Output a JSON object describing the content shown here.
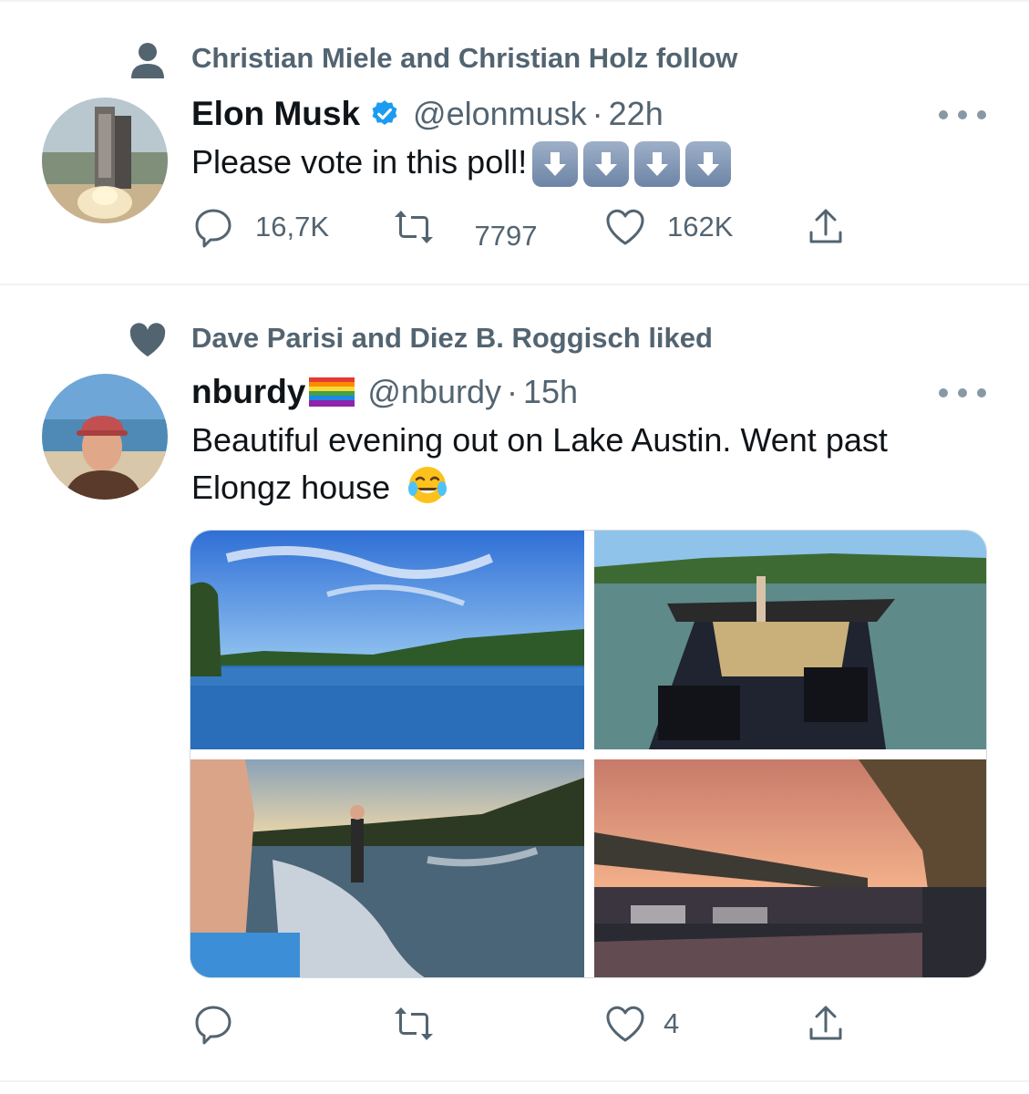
{
  "tweets": [
    {
      "social_context": "Christian Miele and Christian Holz follow",
      "name": "Elon Musk",
      "handle": "@elonmusk",
      "separator": "·",
      "time": "22h",
      "text": "Please vote in this poll!",
      "emoji": [
        "down-arrow-button",
        "down-arrow-button",
        "down-arrow-button",
        "down-arrow-button"
      ],
      "replies": "16,7K",
      "retweets_prev": "7797",
      "retweets": "7797",
      "likes": "162K"
    },
    {
      "social_context": "Dave Parisi and Diez B. Roggisch liked",
      "name": "nburdy",
      "name_emoji": "rainbow-flag",
      "handle": "@nburdy",
      "separator": "·",
      "time": "15h",
      "text_line1": "Beautiful evening out on Lake Austin. Went past",
      "text_line2": "Elongz house",
      "text_emoji": "tears-of-joy-face",
      "replies": "",
      "retweets": "",
      "likes": "4",
      "photos": [
        "lake-view",
        "boat-deck",
        "wakesurfing",
        "boathouse-sunset"
      ]
    }
  ],
  "colors": {
    "secondary_text": "#536471",
    "primary_text": "#0f1419",
    "verified_blue": "#1d9bf0",
    "divider": "#eff3f4"
  }
}
